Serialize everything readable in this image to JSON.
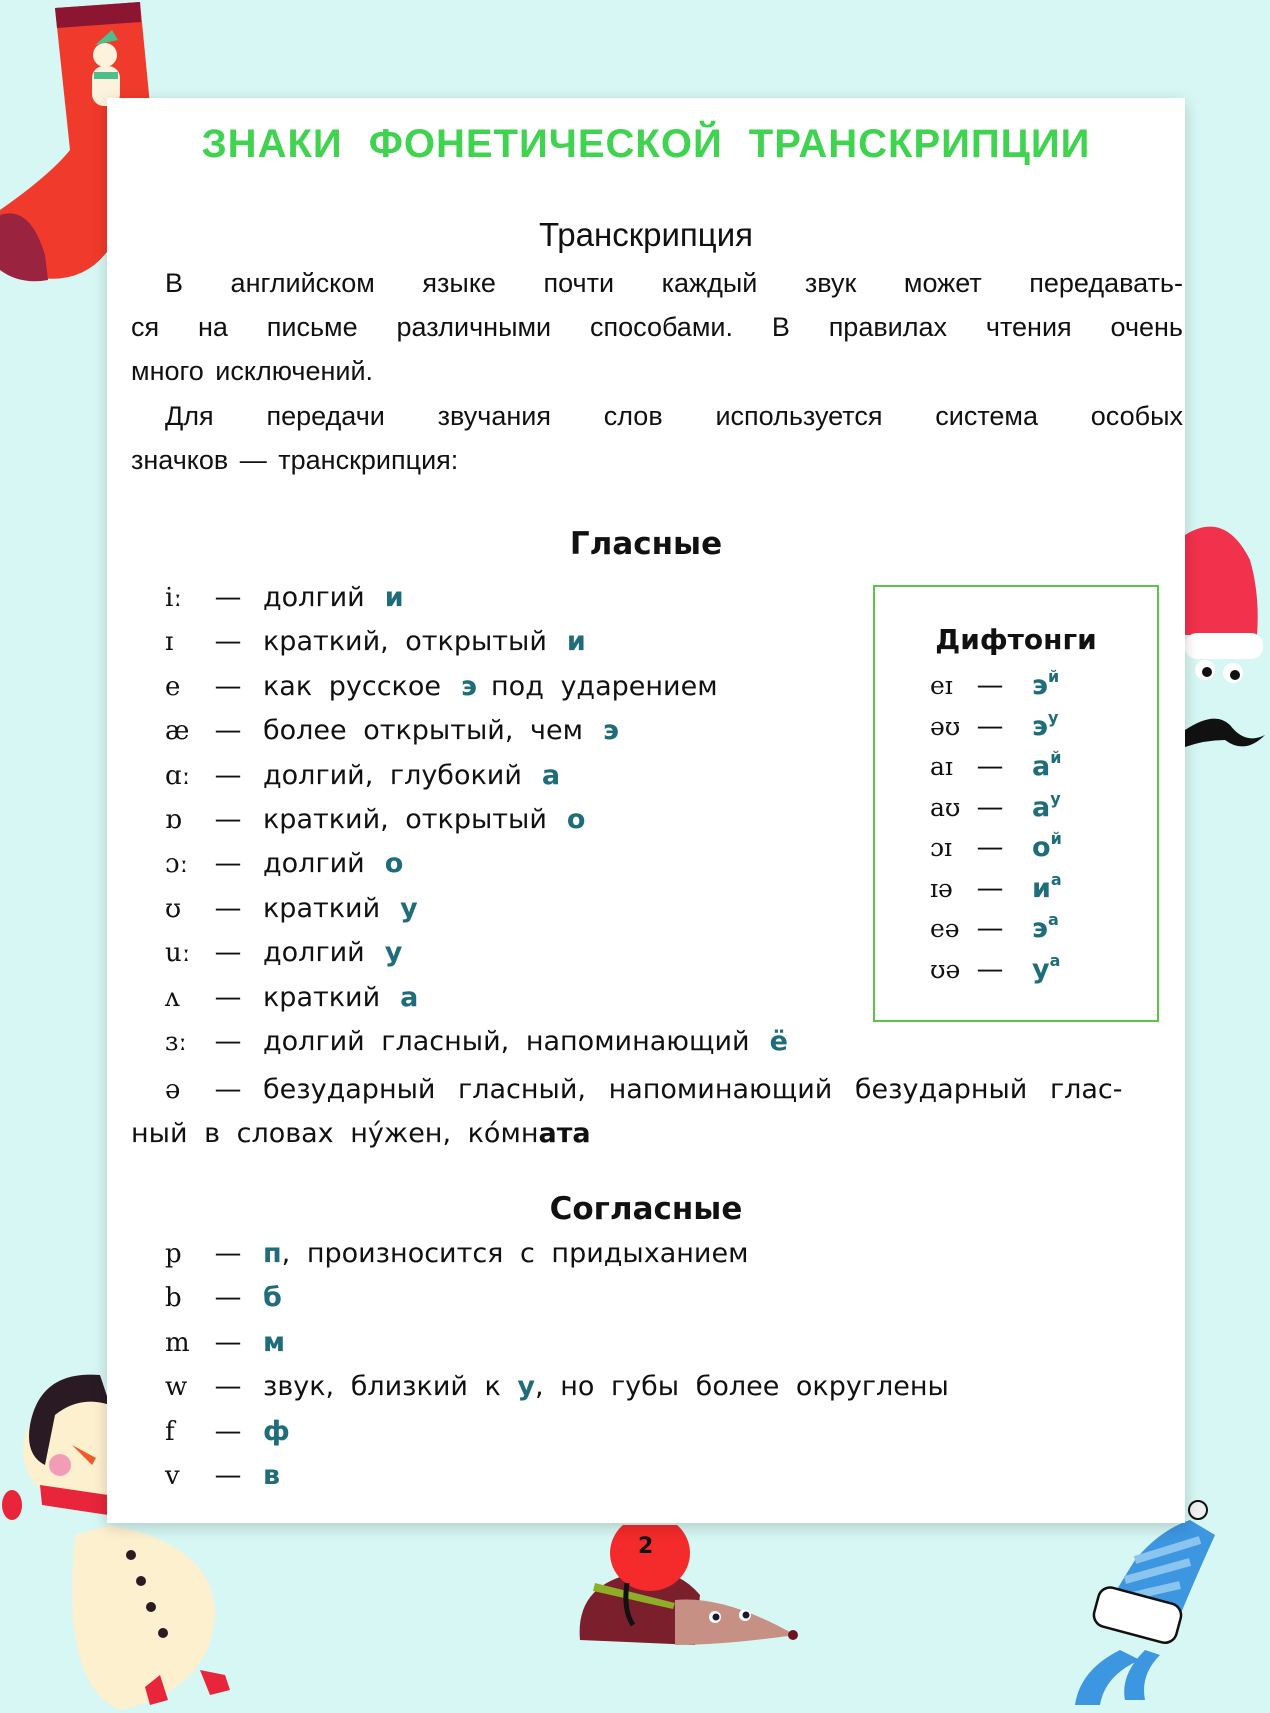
{
  "page": {
    "title": "ЗНАКИ ФОНЕТИЧЕСКОЙ ТРАНСКРИПЦИИ",
    "page_number": "2",
    "colors": {
      "title": "#3fd34f",
      "highlight": "#1f6d7a",
      "box_border": "#5cc446",
      "background": "#d6f7f3"
    }
  },
  "intro": {
    "heading": "Транскрипция",
    "lines": [
      "В английском языке почти каждый звук может передавать-",
      "ся на письме различными способами. В правилах чтения очень",
      "много исключений.",
      "Для передачи звучания слов используется система особых",
      "значков — транскрипция:"
    ]
  },
  "vowels": {
    "heading": "Гласные",
    "items": [
      {
        "symbol": "iː",
        "dash": "—",
        "text": "долгий",
        "highlight": "и",
        "after": ""
      },
      {
        "symbol": "ɪ",
        "dash": "—",
        "text": "краткий, открытый",
        "highlight": "и",
        "after": ""
      },
      {
        "symbol": "e",
        "dash": "—",
        "text": "как русское",
        "highlight": "э",
        "after": "под ударением"
      },
      {
        "symbol": "æ",
        "dash": "—",
        "text": "более открытый, чем",
        "highlight": "э",
        "after": ""
      },
      {
        "symbol": "ɑː",
        "dash": "—",
        "text": "долгий, глубокий",
        "highlight": "а",
        "after": ""
      },
      {
        "symbol": "ɒ",
        "dash": "—",
        "text": "краткий, открытый",
        "highlight": "о",
        "after": ""
      },
      {
        "symbol": "ɔː",
        "dash": "—",
        "text": "долгий",
        "highlight": "о",
        "after": ""
      },
      {
        "symbol": "ʊ",
        "dash": "—",
        "text": "краткий",
        "highlight": "у",
        "after": ""
      },
      {
        "symbol": "uː",
        "dash": "—",
        "text": "долгий",
        "highlight": "у",
        "after": ""
      },
      {
        "symbol": "ʌ",
        "dash": "—",
        "text": "краткий",
        "highlight": "а",
        "after": ""
      },
      {
        "symbol": "ɜː",
        "dash": "—",
        "text": "долгий гласный, напоминающий",
        "highlight": "ё",
        "after": ""
      }
    ],
    "schwa": {
      "symbol": "ə",
      "dash": "—",
      "line1": "безударный гласный, напоминающий безударный глас-",
      "line2_prefix": "ный в словах ну́жен, ко́мн",
      "line2_bold": "ата"
    }
  },
  "diphthongs": {
    "heading": "Дифтонги",
    "items": [
      {
        "symbol": "eɪ",
        "dash": "—",
        "base": "э",
        "sup": "й"
      },
      {
        "symbol": "əʊ",
        "dash": "—",
        "base": "э",
        "sup": "у"
      },
      {
        "symbol": "aɪ",
        "dash": "—",
        "base": "а",
        "sup": "й"
      },
      {
        "symbol": "aʊ",
        "dash": "—",
        "base": "а",
        "sup": "у"
      },
      {
        "symbol": "ɔɪ",
        "dash": "—",
        "base": "о",
        "sup": "й"
      },
      {
        "symbol": "ɪə",
        "dash": "—",
        "base": "и",
        "sup": "а"
      },
      {
        "symbol": "eə",
        "dash": "—",
        "base": "э",
        "sup": "а"
      },
      {
        "symbol": "ʊə",
        "dash": "—",
        "base": "у",
        "sup": "а"
      }
    ]
  },
  "consonants": {
    "heading": "Согласные",
    "items": [
      {
        "symbol": "p",
        "dash": "—",
        "before": "",
        "highlight": "п",
        "after": ", произносится с придыханием"
      },
      {
        "symbol": "b",
        "dash": "—",
        "before": "",
        "highlight": "б",
        "after": ""
      },
      {
        "symbol": "m",
        "dash": "—",
        "before": "",
        "highlight": "м",
        "after": ""
      },
      {
        "symbol": "w",
        "dash": "—",
        "before": "звук, близкий к ",
        "highlight": "у",
        "after": ", но губы более округлены"
      },
      {
        "symbol": "f",
        "dash": "—",
        "before": "",
        "highlight": "ф",
        "after": ""
      },
      {
        "symbol": "v",
        "dash": "—",
        "before": "",
        "highlight": "в",
        "after": ""
      }
    ]
  }
}
